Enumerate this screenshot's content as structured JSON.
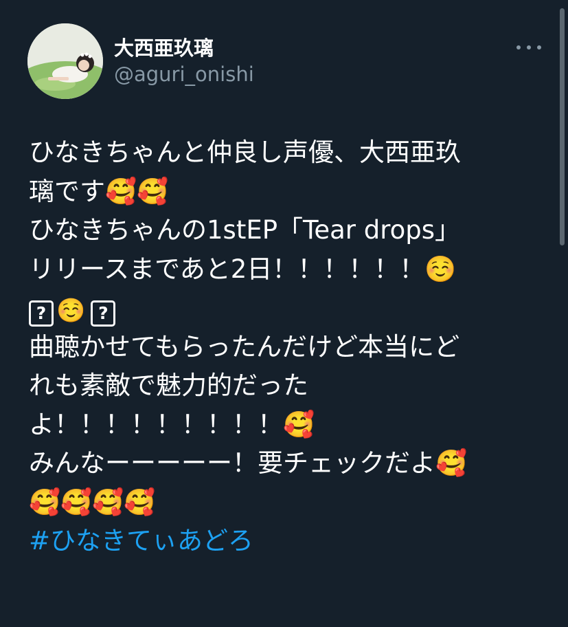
{
  "tweet": {
    "display_name": "大西亜玖璃",
    "handle": "@aguri_onishi",
    "more_icon": "ellipsis-icon",
    "lines": [
      "ひなきちゃんと仲良し声優、大西亜玖",
      "璃です🥰🥰",
      "ひなきちゃんの1stEP「Tear drops」",
      "リリースまであと2日！！！！！！☺️",
      "?☺️?",
      "曲聴かせてもらったんだけど本当にど",
      "れも素敵で魅力的だった",
      "よ！！！！！！！！！🥰",
      "みんなーーーーー！要チェックだよ🥰",
      "🥰🥰🥰🥰"
    ],
    "line5_parts": {
      "box1": "?",
      "emoji": "☺️",
      "box2": "?"
    },
    "hashtag": "#ひなきてぃあどろ"
  },
  "colors": {
    "background": "#15202b",
    "text": "#ffffff",
    "secondary": "#8899a6",
    "link": "#1da1f2"
  }
}
